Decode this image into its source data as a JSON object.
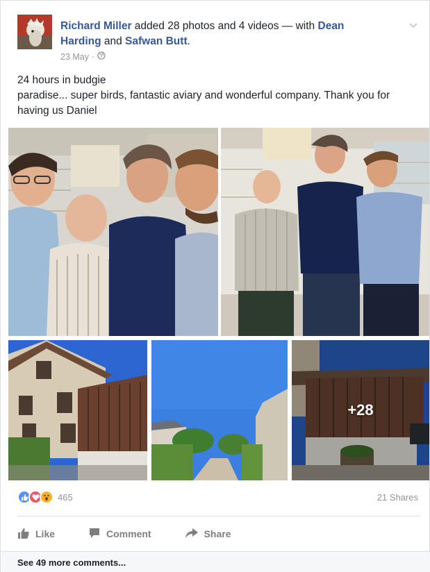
{
  "post": {
    "author": "Richard Miller",
    "action_text": " added 28 photos and 4 videos — with ",
    "tagged_1": "Dean Harding",
    "conjunction": " and ",
    "tagged_2": "Safwan Butt",
    "period": ".",
    "date": "23 May",
    "separator": "·",
    "privacy_icon": "globe-icon",
    "text_line1": "24 hours in budgie",
    "text_line2": "paradise... super birds, fantastic aviary and wonderful company. Thank you for having us Daniel"
  },
  "photos": {
    "more_count": "+28"
  },
  "stats": {
    "reaction_icons": [
      "like-icon",
      "love-icon",
      "wow-icon"
    ],
    "reaction_count": "465",
    "shares": "21 Shares"
  },
  "actions": {
    "like": "Like",
    "comment": "Comment",
    "share": "Share"
  },
  "comments": {
    "see_more": "See 49 more comments..."
  },
  "colors": {
    "link": "#365899",
    "muted": "#90949c",
    "like_blue": "#5890ff",
    "love_red": "#f25268",
    "wow_yellow": "#f7b125"
  }
}
